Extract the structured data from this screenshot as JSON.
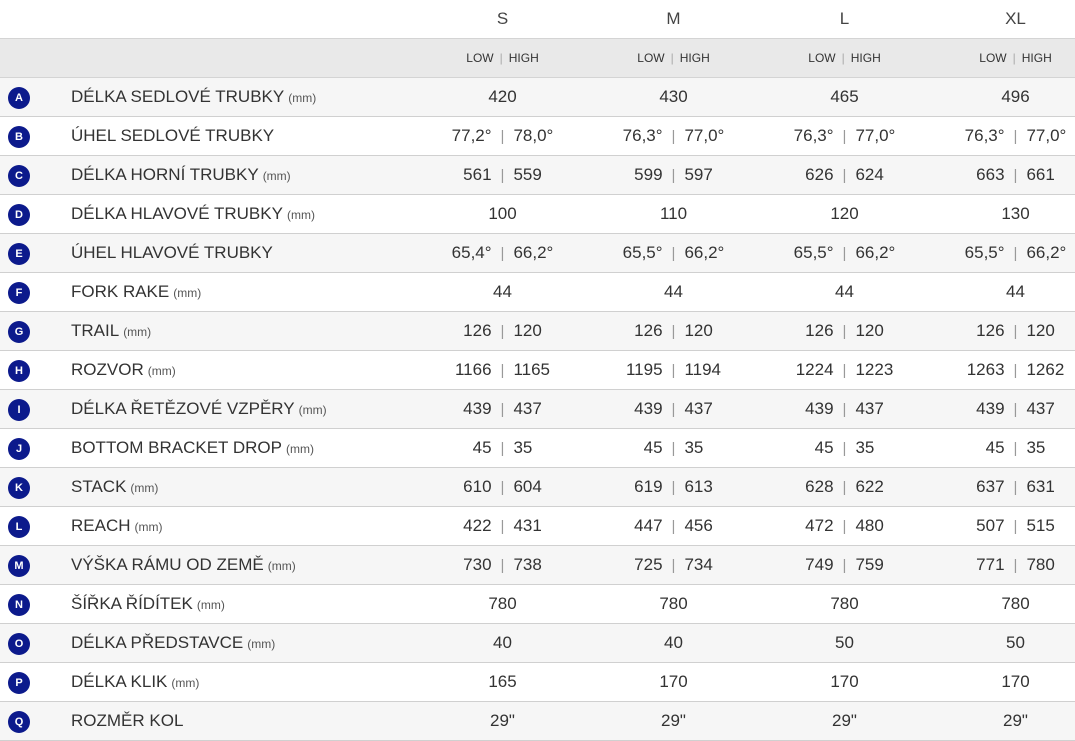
{
  "sizes": [
    "S",
    "M",
    "L",
    "XL"
  ],
  "sub_header": {
    "low": "LOW",
    "separator": "|",
    "high": "HIGH"
  },
  "rows": [
    {
      "letter": "A",
      "label": "DÉLKA SEDLOVÉ TRUBKY",
      "unit": "(mm)",
      "values": [
        "420",
        "430",
        "465",
        "496"
      ]
    },
    {
      "letter": "B",
      "label": "ÚHEL SEDLOVÉ TRUBKY",
      "unit": "",
      "values": [
        [
          "77,2°",
          "78,0°"
        ],
        [
          "76,3°",
          "77,0°"
        ],
        [
          "76,3°",
          "77,0°"
        ],
        [
          "76,3°",
          "77,0°"
        ]
      ]
    },
    {
      "letter": "C",
      "label": "DÉLKA HORNÍ TRUBKY",
      "unit": "(mm)",
      "values": [
        [
          "561",
          "559"
        ],
        [
          "599",
          "597"
        ],
        [
          "626",
          "624"
        ],
        [
          "663",
          "661"
        ]
      ]
    },
    {
      "letter": "D",
      "label": "DÉLKA HLAVOVÉ TRUBKY",
      "unit": "(mm)",
      "values": [
        "100",
        "110",
        "120",
        "130"
      ]
    },
    {
      "letter": "E",
      "label": "ÚHEL HLAVOVÉ TRUBKY",
      "unit": "",
      "values": [
        [
          "65,4°",
          "66,2°"
        ],
        [
          "65,5°",
          "66,2°"
        ],
        [
          "65,5°",
          "66,2°"
        ],
        [
          "65,5°",
          "66,2°"
        ]
      ]
    },
    {
      "letter": "F",
      "label": "FORK RAKE",
      "unit": "(mm)",
      "values": [
        "44",
        "44",
        "44",
        "44"
      ]
    },
    {
      "letter": "G",
      "label": "TRAIL",
      "unit": "(mm)",
      "values": [
        [
          "126",
          "120"
        ],
        [
          "126",
          "120"
        ],
        [
          "126",
          "120"
        ],
        [
          "126",
          "120"
        ]
      ]
    },
    {
      "letter": "H",
      "label": "ROZVOR",
      "unit": "(mm)",
      "values": [
        [
          "1166",
          "1165"
        ],
        [
          "1195",
          "1194"
        ],
        [
          "1224",
          "1223"
        ],
        [
          "1263",
          "1262"
        ]
      ]
    },
    {
      "letter": "I",
      "label": "DÉLKA ŘETĚZOVÉ VZPĚRY",
      "unit": "(mm)",
      "values": [
        [
          "439",
          "437"
        ],
        [
          "439",
          "437"
        ],
        [
          "439",
          "437"
        ],
        [
          "439",
          "437"
        ]
      ]
    },
    {
      "letter": "J",
      "label": "BOTTOM BRACKET DROP",
      "unit": "(mm)",
      "values": [
        [
          "45",
          "35"
        ],
        [
          "45",
          "35"
        ],
        [
          "45",
          "35"
        ],
        [
          "45",
          "35"
        ]
      ]
    },
    {
      "letter": "K",
      "label": "STACK",
      "unit": "(mm)",
      "values": [
        [
          "610",
          "604"
        ],
        [
          "619",
          "613"
        ],
        [
          "628",
          "622"
        ],
        [
          "637",
          "631"
        ]
      ]
    },
    {
      "letter": "L",
      "label": "REACH",
      "unit": "(mm)",
      "values": [
        [
          "422",
          "431"
        ],
        [
          "447",
          "456"
        ],
        [
          "472",
          "480"
        ],
        [
          "507",
          "515"
        ]
      ]
    },
    {
      "letter": "M",
      "label": "VÝŠKA RÁMU OD ZEMĚ",
      "unit": "(mm)",
      "values": [
        [
          "730",
          "738"
        ],
        [
          "725",
          "734"
        ],
        [
          "749",
          "759"
        ],
        [
          "771",
          "780"
        ]
      ]
    },
    {
      "letter": "N",
      "label": "ŠÍŘKA ŘÍDÍTEK",
      "unit": "(mm)",
      "values": [
        "780",
        "780",
        "780",
        "780"
      ]
    },
    {
      "letter": "O",
      "label": "DÉLKA PŘEDSTAVCE",
      "unit": "(mm)",
      "values": [
        "40",
        "40",
        "50",
        "50"
      ]
    },
    {
      "letter": "P",
      "label": "DÉLKA KLIK",
      "unit": "(mm)",
      "values": [
        "165",
        "170",
        "170",
        "170"
      ]
    },
    {
      "letter": "Q",
      "label": "ROZMĚR KOL",
      "unit": "",
      "values": [
        "29\"",
        "29\"",
        "29\"",
        "29\""
      ]
    }
  ]
}
